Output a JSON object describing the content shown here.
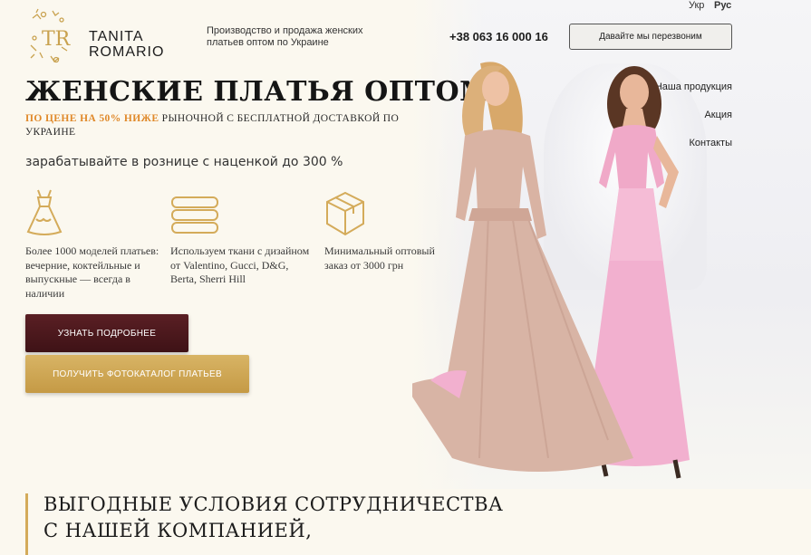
{
  "header": {
    "logo_monogram": "TR",
    "logo_line1": "TANITA",
    "logo_line2": "ROMARIO",
    "tagline": "Производство и продажа женских платьев оптом по Украине",
    "phone": "+38 063 16 000 16",
    "callback_label": "Давайте мы перезвоним",
    "lang_ukr": "Укр",
    "lang_rus": "Рус"
  },
  "nav": {
    "items": [
      "Наша продукция",
      "Акция",
      "Контакты"
    ]
  },
  "hero": {
    "title": "ЖЕНСКИЕ ПЛАТЬЯ ОПТОМ",
    "subtitle_accent": "ПО ЦЕНЕ НА 50% НИЖЕ",
    "subtitle_rest": " РЫНОЧНОЙ С БЕСПЛАТНОЙ ДОСТАВКОЙ ПО УКРАИНЕ",
    "earn": "зарабатывайте в рознице с наценкой до 300 %"
  },
  "features": [
    {
      "icon": "dress-icon",
      "text": "Более 1000 моделей платьев: вечерние, коктейльные и выпускные — всегда в наличии"
    },
    {
      "icon": "fabric-icon",
      "text": "Используем ткани с дизайном от Valentino, Gucci, D&G, Berta, Sherri Hill"
    },
    {
      "icon": "box-icon",
      "text": "Минимальный оптовый заказ от 3000 грн"
    }
  ],
  "buttons": {
    "more": "УЗНАТЬ ПОДРОБНЕЕ",
    "catalog": "ПОЛУЧИТЬ ФОТОКАТАЛОГ ПЛАТЬЕВ"
  },
  "section": {
    "title_line1": "ВЫГОДНЫЕ УСЛОВИЯ СОТРУДНИЧЕСТВА",
    "title_line2": "С НАШЕЙ КОМПАНИЕЙ,"
  },
  "colors": {
    "gold": "#d4ab5a",
    "burgundy": "#4a1519",
    "accent_orange": "#e0892a",
    "background": "#fbf8ef"
  }
}
